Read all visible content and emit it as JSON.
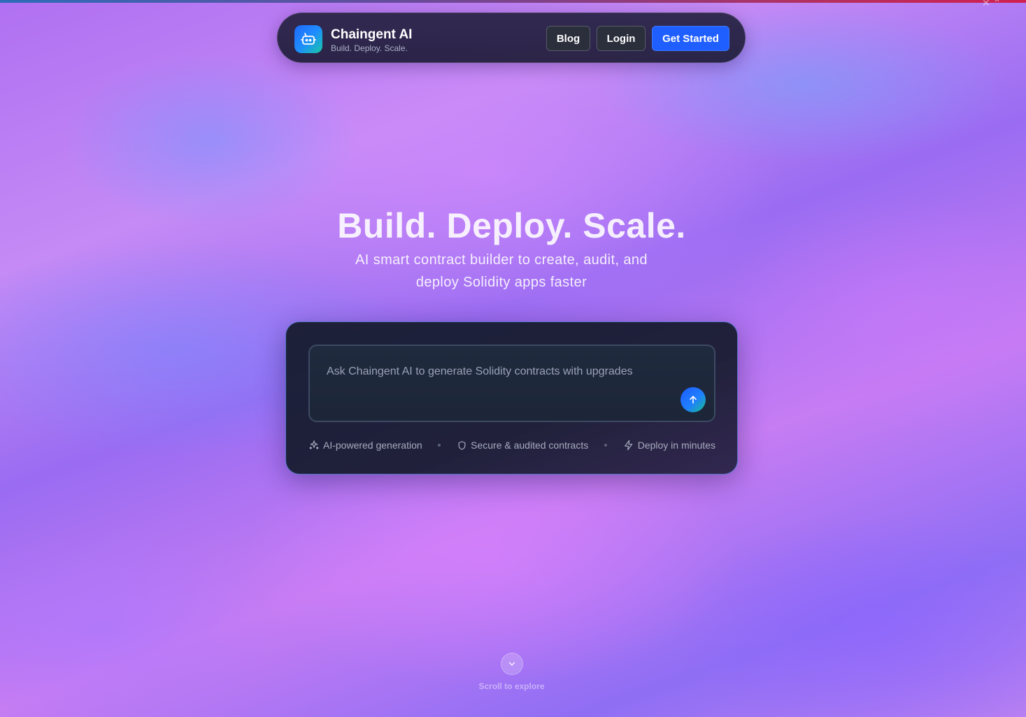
{
  "brand": {
    "name": "Chaingent AI",
    "tagline": "Build. Deploy. Scale.",
    "logo_icon": "bot-icon"
  },
  "nav": {
    "blog_label": "Blog",
    "login_label": "Login",
    "get_started_label": "Get Started"
  },
  "hero": {
    "title": "Build. Deploy. Scale.",
    "subtitle": "AI smart contract builder to create, audit, and deploy Solidity apps faster"
  },
  "prompt": {
    "placeholder": "Ask Chaingent AI to generate Solidity contracts with upgrades",
    "value": "",
    "send_icon": "arrow-up-icon"
  },
  "features": [
    {
      "icon": "sparkles-icon",
      "label": "AI-powered generation"
    },
    {
      "icon": "shield-icon",
      "label": "Secure & audited contracts"
    },
    {
      "icon": "zap-icon",
      "label": "Deploy in minutes"
    }
  ],
  "scroll": {
    "label": "Scroll to explore",
    "icon": "chevron-down-icon"
  },
  "colors": {
    "accent": "#1f5eff",
    "card_border": "#6e96ff",
    "navbar_bg": "#26223f"
  }
}
